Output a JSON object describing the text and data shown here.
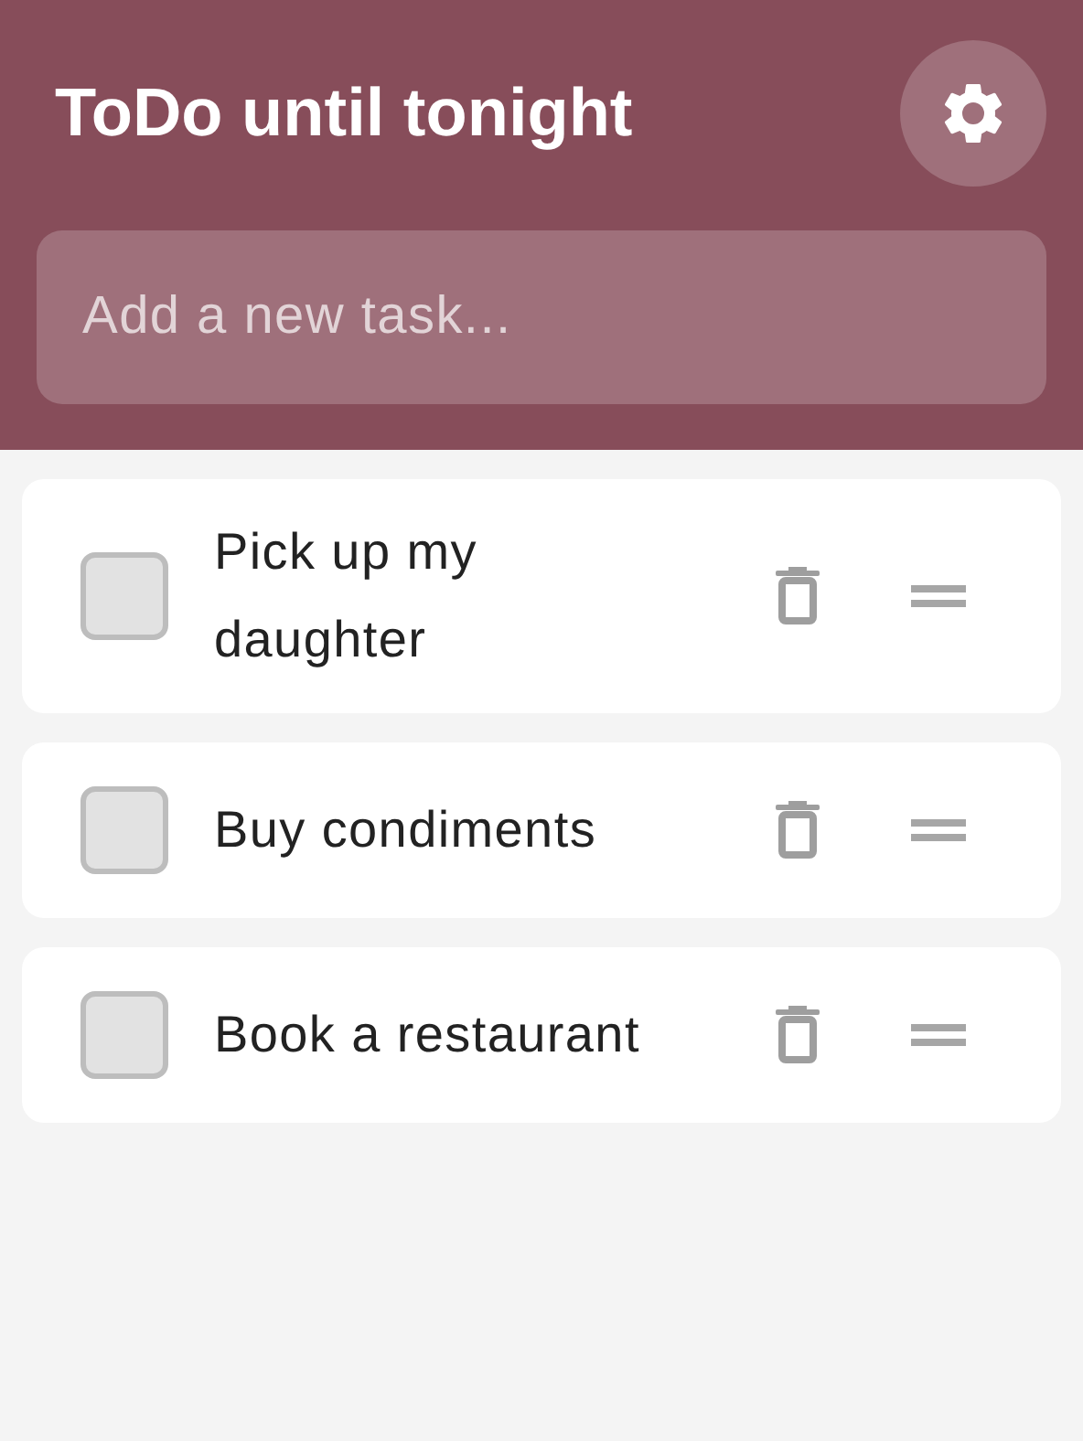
{
  "header": {
    "title": "ToDo until tonight"
  },
  "new_task": {
    "placeholder": "Add a new task..."
  },
  "tasks": [
    {
      "text": "Pick up my daughter",
      "checked": false
    },
    {
      "text": "Buy condiments",
      "checked": false
    },
    {
      "text": "Book a restaurant",
      "checked": false
    }
  ]
}
